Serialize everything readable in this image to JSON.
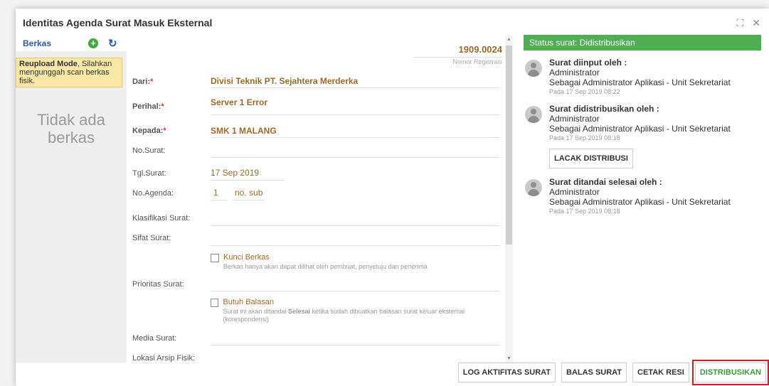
{
  "dialog": {
    "title": "Identitas Agenda Surat Masuk Eksternal",
    "expand_icon": "⛶",
    "close_icon": "✕"
  },
  "left": {
    "label": "Berkas",
    "reupload_bold": "Reupload Mode",
    "reupload_text": ", Silahkan mengunggah scan berkas fisik.",
    "nofile": "Tidak ada berkas"
  },
  "form": {
    "nomor": "1909.0024",
    "nomor_label": "Nomor Registrasi",
    "dari_label": "Dari:",
    "dari_value": "Divisi Teknik PT. Sejahtera Merderka",
    "perihal_label": "Perihal:",
    "perihal_value": "Server 1 Error",
    "kepada_label": "Kepada:",
    "kepada_value": "SMK 1 MALANG",
    "nosurat_label": "No.Surat:",
    "tglsurat_label": "Tgl.Surat:",
    "tglsurat_value": "17 Sep 2019",
    "noagenda_label": "No.Agenda:",
    "noagenda_value": "1",
    "nosub_placeholder": "no. sub",
    "klasifikasi_label": "Klasifikasi Surat:",
    "sifat_label": "Sifat Surat:",
    "kunci_label": "Kunci Berkas",
    "kunci_desc": "Berkas hanya akan dapat dilihat oleh pembuat, penyetuju dan penerima",
    "prioritas_label": "Prioritas Surat:",
    "balasan_label": "Butuh Balasan",
    "balasan_desc_1": "Surat ini akan ditandai ",
    "balasan_desc_bold": "Selesai",
    "balasan_desc_2": " ketika sudah dibuatkan balasan surat keluar eksternal (korespondensi)",
    "media_label": "Media Surat:",
    "lokasi_label": "Lokasi Arsip Fisik:"
  },
  "right": {
    "status": "Status surat: Didistribusikan",
    "items": [
      {
        "head": "Surat diinput oleh :",
        "name": "Administrator",
        "role": "Sebagai Administrator Aplikasi - Unit Sekretariat",
        "date": "Pada 17 Sep 2019 08:22"
      },
      {
        "head": "Surat didistribusikan oleh :",
        "name": "Administrator",
        "role": "Sebagai Administrator Aplikasi - Unit Sekretariat",
        "date": "Pada 17 Sep 2019 08:18"
      },
      {
        "head": "Surat ditandai selesai oleh :",
        "name": "Administrator",
        "role": "Sebagai Administrator Aplikasi - Unit Sekretariat",
        "date": "Pada 17 Sep 2019 08:18"
      }
    ],
    "lacak": "LACAK DISTRIBUSI"
  },
  "buttons": {
    "log": "LOG AKTIFITAS SURAT",
    "balas": "BALAS SURAT",
    "cetak": "CETAK RESI",
    "distribusi": "DISTRIBUSIKAN"
  },
  "colors": {
    "status_bg": "#4caf50",
    "accent_text": "#9a6a2a",
    "link": "#2a5aa5",
    "highlight": "#d42020"
  }
}
